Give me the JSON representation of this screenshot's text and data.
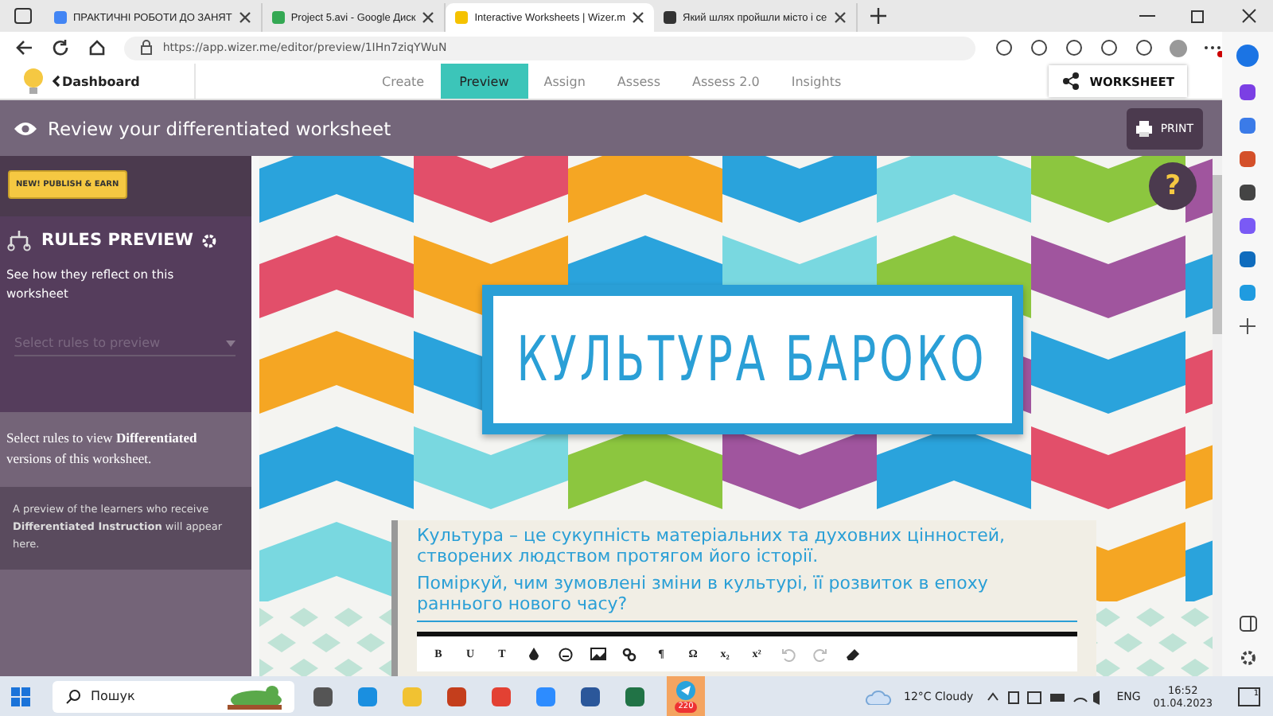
{
  "browser": {
    "tabs": [
      {
        "title": "ПРАКТИЧНІ РОБОТИ ДО ЗАНЯТ",
        "selected": false
      },
      {
        "title": "Project 5.avi - Google Диск",
        "selected": false
      },
      {
        "title": "Interactive Worksheets | Wizer.m",
        "selected": true
      },
      {
        "title": "Який шлях пройшли місто і се",
        "selected": false
      }
    ],
    "url": "https://app.wizer.me/editor/preview/1IHn7ziqYWuN"
  },
  "app_nav": {
    "back_link": "Dashboard",
    "tabs": [
      {
        "label": "Create",
        "selected": false
      },
      {
        "label": "Preview",
        "selected": true
      },
      {
        "label": "Assign",
        "selected": false
      },
      {
        "label": "Assess",
        "selected": false
      },
      {
        "label": "Assess 2.0",
        "selected": false
      },
      {
        "label": "Insights",
        "selected": false
      }
    ],
    "share_button": "WORKSHEET"
  },
  "header": {
    "title": "Review your differentiated worksheet",
    "print_button": "PRINT"
  },
  "sidebar": {
    "publish_button": "NEW! PUBLISH & EARN",
    "rules_title": "RULES PREVIEW",
    "rules_description": "See how they reflect on this worksheet",
    "rules_select": {
      "placeholder": "Select rules to preview"
    },
    "info": "Select rules to view **Differentiated** versions of this worksheet.",
    "note": "A preview of the learners who receive **Differentiated Instruction** will appear here."
  },
  "worksheet": {
    "help_button": "?",
    "title": "КУЛЬТУРА БАРОКО",
    "paragraphs": [
      "Культура – це сукупність матеріальних та духовних цінностей, створених людством протягом його історії.",
      "Поміркуй, чим зумовлені зміни в культурі, її розвиток в епоху раннього нового часу?"
    ],
    "toolbar": [
      {
        "kind": "text",
        "label": "B",
        "disabled": false
      },
      {
        "kind": "text",
        "label": "U",
        "disabled": false
      },
      {
        "kind": "text",
        "label": "T",
        "disabled": false
      },
      {
        "kind": "drop",
        "disabled": false
      },
      {
        "kind": "smiley",
        "disabled": false
      },
      {
        "kind": "image",
        "disabled": false
      },
      {
        "kind": "link",
        "disabled": false
      },
      {
        "kind": "text",
        "label": "¶",
        "disabled": false
      },
      {
        "kind": "text",
        "label": "Ω",
        "disabled": false
      },
      {
        "kind": "text",
        "label": "x₂",
        "disabled": false
      },
      {
        "kind": "text",
        "label": "x²",
        "disabled": false
      },
      {
        "kind": "undo",
        "disabled": true
      },
      {
        "kind": "redo",
        "disabled": true
      },
      {
        "kind": "eraser",
        "disabled": false
      }
    ]
  },
  "taskbar": {
    "search_placeholder": "Пошук",
    "telegram_badge": "220",
    "weather": "12°C Cloudy",
    "language": "ENG",
    "time": "16:52",
    "date": "01.04.2023",
    "notifications": "1"
  }
}
